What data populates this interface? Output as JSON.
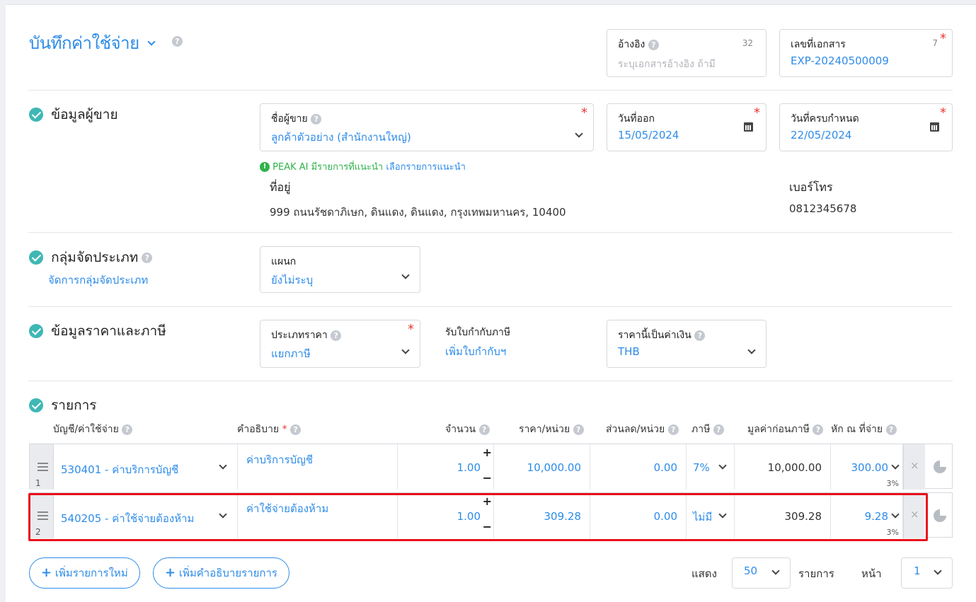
{
  "header": {
    "title": "บันทึกค่าใช้จ่าย",
    "reference": {
      "label": "อ้างอิง",
      "counter": "32",
      "placeholder": "ระบุเอกสารอ้างอิง ถ้ามี"
    },
    "doc_number": {
      "label": "เลขที่เอกสาร",
      "counter": "7",
      "value": "EXP-20240500009"
    }
  },
  "vendor": {
    "section_title": "ข้อมูลผู้ขาย",
    "name_label": "ชื่อผู้ขาย",
    "name_value": "ลูกค้าตัวอย่าง (สำนักงานใหญ่)",
    "issue_date_label": "วันที่ออก",
    "issue_date": "15/05/2024",
    "due_date_label": "วันที่ครบกำหนด",
    "due_date": "22/05/2024",
    "ai_hint": "PEAK AI มีรายการที่แนะนำ",
    "ai_link": "เลือกรายการแนะนำ",
    "address_label": "ที่อยู่",
    "address": "999 ถนนรัชดาภิเษก, ดินแดง, ดินแดง, กรุงเทพมหานคร, 10400",
    "phone_label": "เบอร์โทร",
    "phone": "0812345678"
  },
  "classification": {
    "section_title": "กลุ่มจัดประเภท",
    "manage_link": "จัดการกลุ่มจัดประเภท",
    "dept_label": "แผนก",
    "dept_value": "ยังไม่ระบุ"
  },
  "pricing": {
    "section_title": "ข้อมูลราคาและภาษี",
    "price_type_label": "ประเภทราคา",
    "price_type_value": "แยกภาษี",
    "tax_invoice_label": "รับใบกำกับภาษี",
    "tax_invoice_link": "เพิ่มใบกำกับฯ",
    "currency_label": "ราคานี้เป็นค่าเงิน",
    "currency_value": "THB"
  },
  "items": {
    "section_title": "รายการ",
    "columns": {
      "account": "บัญชี/ค่าใช้จ่าย",
      "description": "คำอธิบาย",
      "qty": "จำนวน",
      "price": "ราคา/หน่วย",
      "discount": "ส่วนลด/หน่วย",
      "tax": "ภาษี",
      "pretax": "มูลค่าก่อนภาษี",
      "wht": "หัก ณ ที่จ่าย"
    },
    "rows": [
      {
        "no": "1",
        "account": "530401 - ค่าบริการบัญชี",
        "description": "ค่าบริการบัญชี",
        "qty": "1.00",
        "price": "10,000.00",
        "discount": "0.00",
        "tax": "7%",
        "pretax": "10,000.00",
        "wht": "300.00",
        "wht_rate": "3%"
      },
      {
        "no": "2",
        "account": "540205 - ค่าใช้จ่ายต้องห้าม",
        "description": "ค่าใช้จ่ายต้องห้าม",
        "qty": "1.00",
        "price": "309.28",
        "discount": "0.00",
        "tax": "ไม่มี",
        "pretax": "309.28",
        "wht": "9.28",
        "wht_rate": "3%"
      }
    ],
    "add_item": "เพิ่มรายการใหม่",
    "add_description": "เพิ่มคำอธิบายรายการ"
  },
  "pagination": {
    "show_label": "แสดง",
    "page_size": "50",
    "items_label": "รายการ",
    "page_label": "หน้า",
    "page": "1"
  },
  "colors": {
    "accent": "#2e8ce8",
    "check": "#3fb7b5",
    "highlight": "#e8101a",
    "required": "#e53935"
  }
}
